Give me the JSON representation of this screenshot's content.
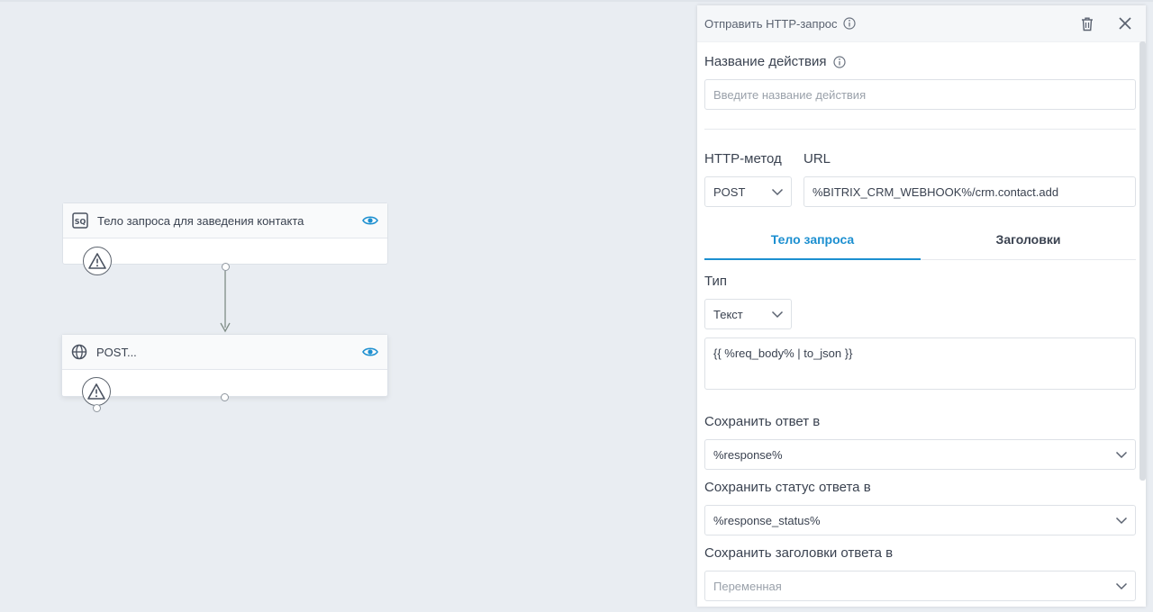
{
  "canvas": {
    "node1": {
      "title": "Тело запроса для заведения контакта",
      "icon": "sql-icon"
    },
    "node2": {
      "title": "POST...",
      "icon": "globe-icon"
    }
  },
  "panel": {
    "title": "Отправить HTTP-запрос",
    "action_name_label": "Название действия",
    "action_name_placeholder": "Введите название действия",
    "http_method_label": "HTTP-метод",
    "http_method_value": "POST",
    "url_label": "URL",
    "url_value": "%BITRIX_CRM_WEBHOOK%/crm.contact.add",
    "tabs": [
      "Тело запроса",
      "Заголовки"
    ],
    "type_label": "Тип",
    "type_value": "Текст",
    "body_value": "{{ %req_body% | to_json }}",
    "save_response_label": "Сохранить ответ в",
    "save_response_value": "%response%",
    "save_status_label": "Сохранить статус ответа в",
    "save_status_value": "%response_status%",
    "save_headers_label": "Сохранить заголовки ответа в",
    "save_headers_placeholder": "Переменная"
  },
  "colors": {
    "accent": "#1c8fd0",
    "canvas": "#e9edf2"
  }
}
